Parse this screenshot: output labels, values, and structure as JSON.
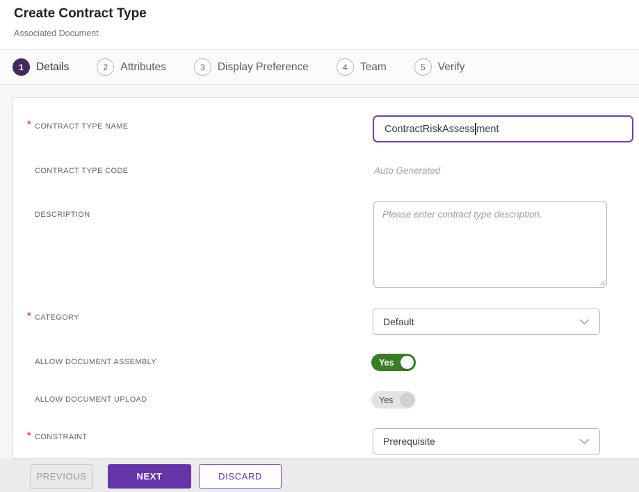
{
  "header": {
    "title": "Create Contract Type",
    "subtitle": "Associated Document"
  },
  "steps": [
    {
      "number": "1",
      "label": "Details",
      "active": true
    },
    {
      "number": "2",
      "label": "Attributes",
      "active": false
    },
    {
      "number": "3",
      "label": "Display Preference",
      "active": false
    },
    {
      "number": "4",
      "label": "Team",
      "active": false
    },
    {
      "number": "5",
      "label": "Verify",
      "active": false
    }
  ],
  "required_marker": "*",
  "form": {
    "contract_type_name": {
      "label": "CONTRACT TYPE NAME",
      "required": true,
      "value": "ContractRiskAssessment",
      "value_before_cursor": "ContractRiskAssess",
      "value_after_cursor": "ment"
    },
    "contract_type_code": {
      "label": "CONTRACT TYPE CODE",
      "placeholder": "Auto Generated"
    },
    "description": {
      "label": "DESCRIPTION",
      "placeholder": "Please enter contract type description."
    },
    "category": {
      "label": "CATEGORY",
      "required": true,
      "value": "Default"
    },
    "allow_document_assembly": {
      "label": "ALLOW DOCUMENT ASSEMBLY",
      "value": "Yes",
      "state": "on"
    },
    "allow_document_upload": {
      "label": "ALLOW DOCUMENT UPLOAD",
      "value": "Yes",
      "state": "off"
    },
    "constraint": {
      "label": "CONSTRAINT",
      "required": true,
      "value": "Prerequisite"
    }
  },
  "footer": {
    "previous_label": "PREVIOUS",
    "next_label": "NEXT",
    "discard_label": "DISCARD"
  },
  "colors": {
    "accent_purple": "#6534a8",
    "step_active_purple": "#44285f",
    "toggle_on_green": "#3a7d27",
    "required_red": "#e8483f",
    "input_focus_border": "#6e3cb5"
  }
}
